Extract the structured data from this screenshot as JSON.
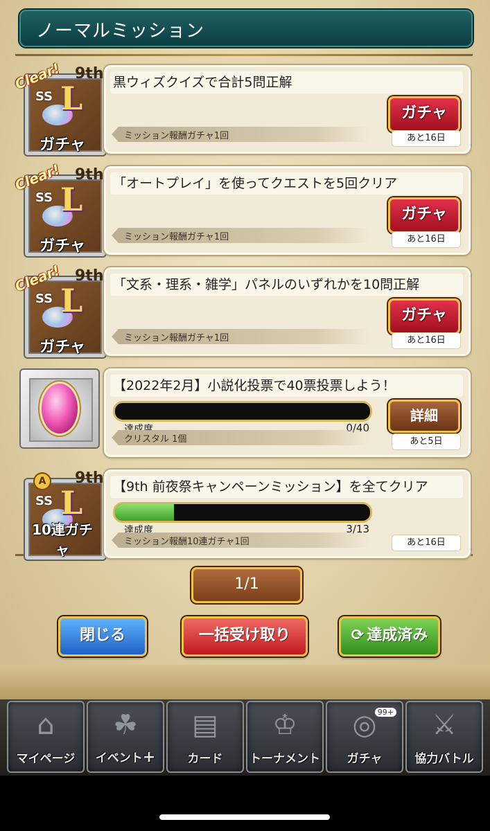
{
  "header": {
    "title": "ノーマルミッション"
  },
  "missions": [
    {
      "title": "黒ウィズクイズで合計5問正解",
      "reward": "ミッション報酬ガチャ1回",
      "remain": "あと16日",
      "button": "ガチャ",
      "icon_label": "ガチャ",
      "clear": "Clear!",
      "ninth": "9th"
    },
    {
      "title": "「オートプレイ」を使ってクエストを5回クリア",
      "reward": "ミッション報酬ガチャ1回",
      "remain": "あと16日",
      "button": "ガチャ",
      "icon_label": "ガチャ",
      "clear": "Clear!",
      "ninth": "9th"
    },
    {
      "title": "「文系・理系・雑学」パネルのいずれかを10問正解",
      "reward": "ミッション報酬ガチャ1回",
      "remain": "あと16日",
      "button": "ガチャ",
      "icon_label": "ガチャ",
      "clear": "Clear!",
      "ninth": "9th"
    },
    {
      "title": "【2022年2月】小説化投票で40票投票しよう！",
      "progress_label": "達成度",
      "progress_value": "0/40",
      "progress_fraction": 0.0,
      "reward": "クリスタル 1個",
      "remain": "あと5日",
      "button": "詳細"
    },
    {
      "title": "【9th 前夜祭キャンペーンミッション】を全てクリア",
      "progress_label": "達成度",
      "progress_value": "3/13",
      "progress_fraction": 0.23,
      "reward": "ミッション報酬10連ガチャ1回",
      "remain": "あと16日",
      "icon_label": "10連ガチャ",
      "ninth": "9th",
      "badge": "A"
    }
  ],
  "icon_ss": "SS",
  "icon_L": "L",
  "pager": {
    "label": "1/1"
  },
  "buttons": {
    "close": "閉じる",
    "bulk": "一括受け取り",
    "done": "達成済み"
  },
  "tabs": [
    {
      "label": "マイページ",
      "icon": "house-icon"
    },
    {
      "label": "イベント",
      "icon": "cat-icon"
    },
    {
      "label": "カード",
      "icon": "cards-icon"
    },
    {
      "label": "トーナメント",
      "icon": "trophy-icon"
    },
    {
      "label": "ガチャ",
      "icon": "gacha-icon",
      "badge": "99+"
    },
    {
      "label": "協力バトル",
      "icon": "team-icon"
    }
  ]
}
